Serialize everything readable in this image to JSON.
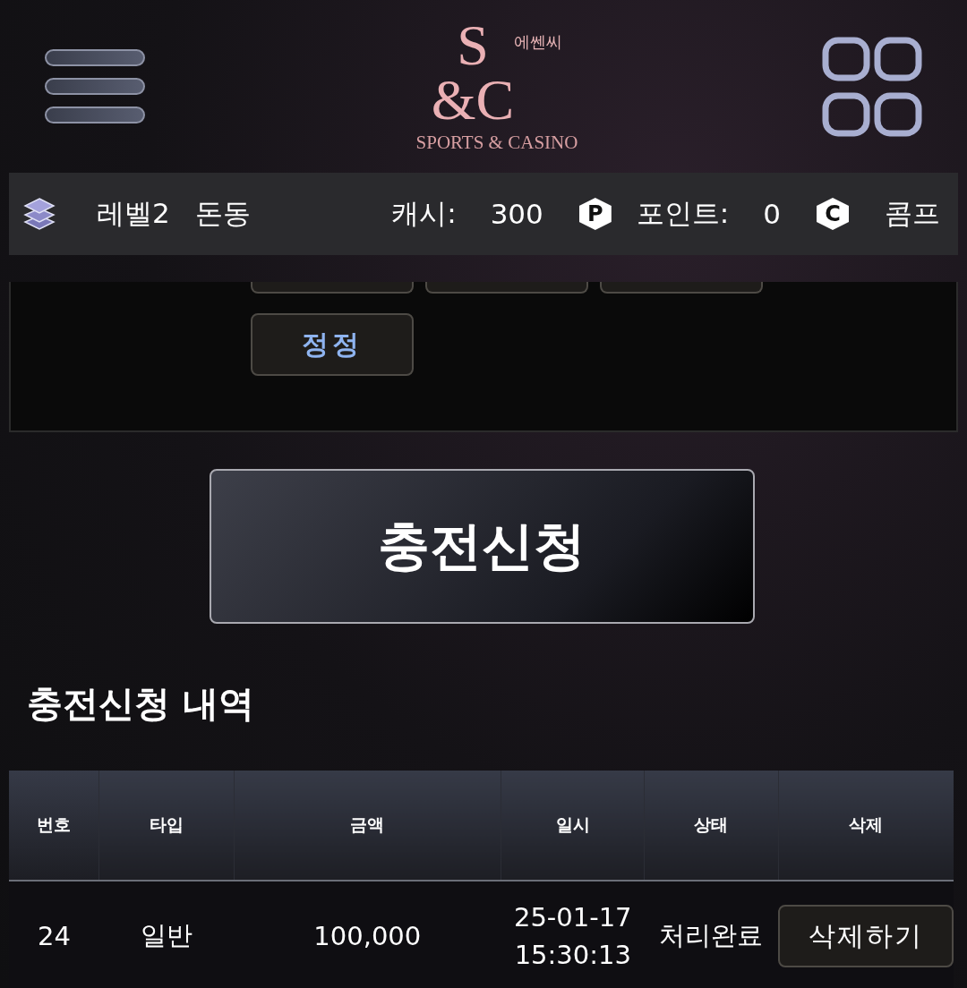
{
  "logo": {
    "monogram_top": "S",
    "monogram_bottom": "&C",
    "korean": "에쎈씨",
    "tagline": "SPORTS & CASINO"
  },
  "status_bar": {
    "level": "레벨2",
    "username": "돈동",
    "cash_label": "캐시:",
    "cash": "300",
    "cash_badge": "P",
    "points_label": "포인트:",
    "points": "0",
    "points_badge": "C",
    "comp": "콤프"
  },
  "amount_panel": {
    "partial_buttons": [
      {
        "kind": "cut_off"
      },
      {
        "kind": "cut_off"
      },
      {
        "kind": "cut_off"
      }
    ],
    "buttons": [
      "정정"
    ]
  },
  "submit_button": "충전신청",
  "history": {
    "title": "충전신청 내역",
    "columns": [
      "번호",
      "타입",
      "금액",
      "일시",
      "상태",
      "삭제"
    ],
    "rows": [
      {
        "number": "24",
        "type": "일반",
        "amount": "100,000",
        "date": "25-01-17",
        "time": "15:30:13",
        "status": "처리완료",
        "action": "삭제하기"
      }
    ]
  }
}
